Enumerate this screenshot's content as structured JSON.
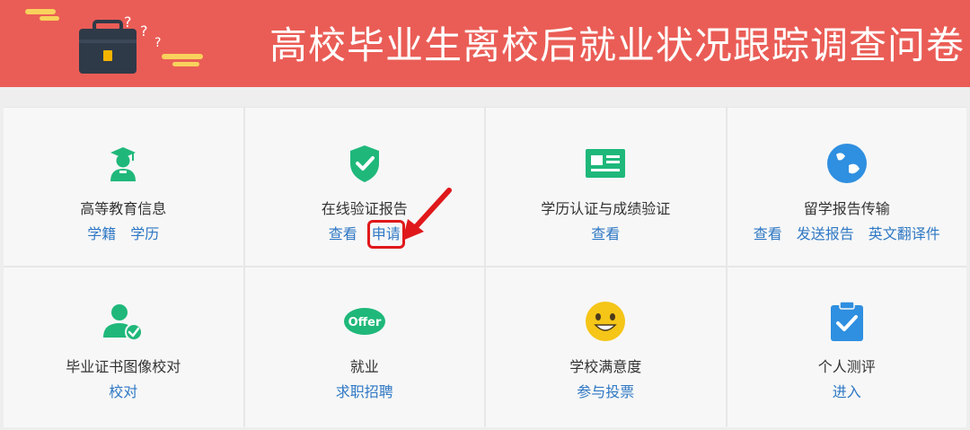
{
  "banner": {
    "title": "高校毕业生离校后就业状况跟踪调查问卷",
    "bg_color": "#ea5d56",
    "icons": [
      "briefcase-icon",
      "question-mark-icon",
      "bar-decoration-icon"
    ]
  },
  "tiles": [
    {
      "title": "高等教育信息",
      "icon": "graduate-icon",
      "icon_color": "#1fb87a",
      "links": [
        "学籍",
        "学历"
      ]
    },
    {
      "title": "在线验证报告",
      "icon": "shield-check-icon",
      "icon_color": "#1fb87a",
      "links": [
        "查看",
        "申请"
      ],
      "highlighted_link": "申请"
    },
    {
      "title": "学历认证与成绩验证",
      "icon": "id-card-icon",
      "icon_color": "#1fb87a",
      "links": [
        "查看"
      ]
    },
    {
      "title": "留学报告传输",
      "icon": "globe-icon",
      "icon_color": "#2f8fe0",
      "links": [
        "查看",
        "发送报告",
        "英文翻译件"
      ]
    },
    {
      "title": "毕业证书图像校对",
      "icon": "user-check-icon",
      "icon_color": "#1fb87a",
      "links": [
        "校对"
      ]
    },
    {
      "title": "就业",
      "icon": "offer-icon",
      "icon_color": "#1fb87a",
      "icon_text": "Offer",
      "links": [
        "求职招聘"
      ]
    },
    {
      "title": "学校满意度",
      "icon": "smiley-icon",
      "icon_color": "#f5c518",
      "links": [
        "参与投票"
      ]
    },
    {
      "title": "个人测评",
      "icon": "clipboard-check-icon",
      "icon_color": "#2f8fe0",
      "links": [
        "进入"
      ]
    }
  ],
  "annotation": {
    "icon": "red-arrow-icon",
    "color": "#e0181b"
  }
}
